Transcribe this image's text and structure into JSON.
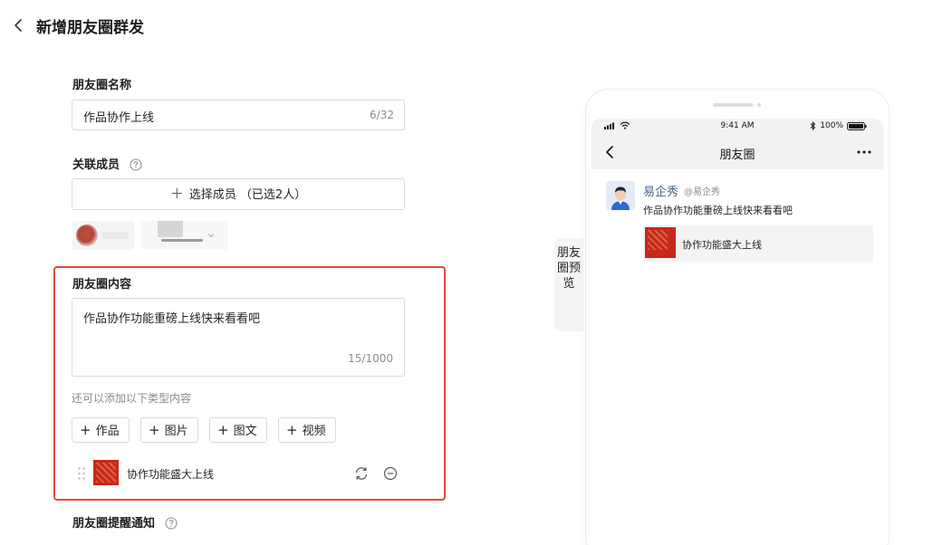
{
  "header": {
    "title": "新增朋友圈群发"
  },
  "form": {
    "name_label": "朋友圈名称",
    "name_value": "作品协作上线",
    "name_count": "6/32",
    "members_label": "关联成员",
    "select_members": "选择成员 （已选2人）",
    "content_label": "朋友圈内容",
    "content_value": "作品协作功能重磅上线快来看看吧",
    "content_count": "15/1000",
    "add_hint": "还可以添加以下类型内容",
    "add_buttons": [
      "作品",
      "图片",
      "图文",
      "视频"
    ],
    "attachment_title": "协作功能盛大上线",
    "notify_label": "朋友圈提醒通知"
  },
  "preview": {
    "tab_label": "朋友圈预览",
    "status_time": "9:41 AM",
    "status_battery": "100%",
    "nav_title": "朋友圈",
    "post_name": "易企秀",
    "post_handle": "@易企秀",
    "post_text": "作品协作功能重磅上线快来看看吧",
    "card_title": "协作功能盛大上线"
  },
  "colors": {
    "highlight": "#e8463b",
    "link_name": "#4b5e8c",
    "thumb_red": "#c8271d"
  }
}
